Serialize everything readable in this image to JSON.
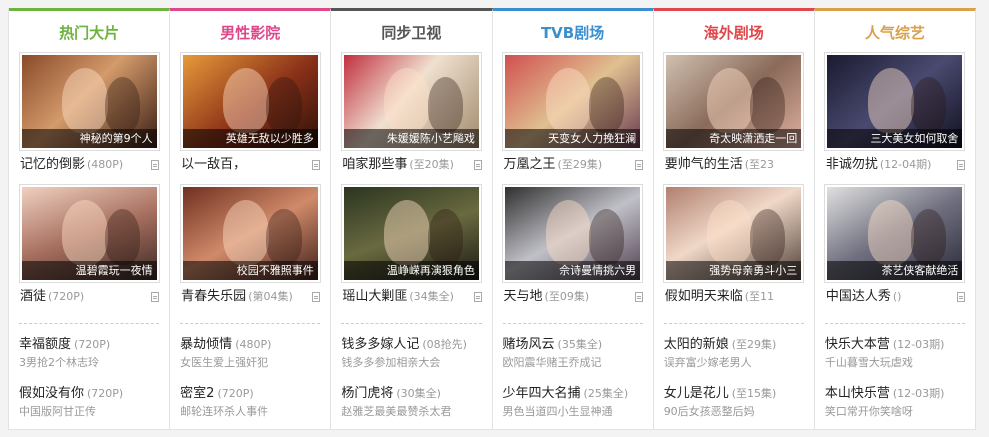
{
  "columns": [
    {
      "title": "热门大片",
      "color": "#6cb33f",
      "thumbs": [
        {
          "caption": "神秘的第9个人",
          "title": "记忆的倒影",
          "meta": "(480P)",
          "doc": true
        },
        {
          "caption": "温碧霞玩一夜情",
          "title": "酒徒",
          "meta": "(720P)",
          "doc": true
        }
      ],
      "texts": [
        {
          "title": "幸福额度",
          "meta": "(720P)",
          "sub": "3男抢2个林志玲"
        },
        {
          "title": "假如没有你",
          "meta": "(720P)",
          "sub": "中国版阿甘正传"
        }
      ]
    },
    {
      "title": "男性影院",
      "color": "#e0478a",
      "thumbs": [
        {
          "caption": "英雄无敌以少胜多",
          "title": "以一敌百，",
          "meta": "",
          "doc": true
        },
        {
          "caption": "校园不雅照事件",
          "title": "青春失乐园",
          "meta": "(第04集)",
          "doc": true
        }
      ],
      "texts": [
        {
          "title": "暴劫倾情",
          "meta": "(480P)",
          "sub": "女医生爱上强奸犯"
        },
        {
          "title": "密室2",
          "meta": "(720P)",
          "sub": "邮轮连环杀人事件"
        }
      ]
    },
    {
      "title": "同步卫视",
      "color": "#555555",
      "thumbs": [
        {
          "caption": "朱媛媛陈小艺飚戏",
          "title": "咱家那些事",
          "meta": "(至20集)",
          "doc": true
        },
        {
          "caption": "温峥嵘再演狠角色",
          "title": "瑶山大剿匪",
          "meta": "(34集全)",
          "doc": true
        }
      ],
      "texts": [
        {
          "title": "钱多多嫁人记",
          "meta": "(08抢先)",
          "sub": "钱多多参加相亲大会"
        },
        {
          "title": "杨门虎将",
          "meta": "(30集全)",
          "sub": "赵雅芝最美最赞杀太君"
        }
      ]
    },
    {
      "title": "TVB剧场",
      "color": "#3a8fd0",
      "thumbs": [
        {
          "caption": "天变女人力挽狂澜",
          "title": "万凰之王",
          "meta": "(至29集)",
          "doc": true
        },
        {
          "caption": "佘诗曼情挑六男",
          "title": "天与地",
          "meta": "(至09集)",
          "doc": true
        }
      ],
      "texts": [
        {
          "title": "赌场风云",
          "meta": "(35集全)",
          "sub": "欧阳震华赌王乔成记"
        },
        {
          "title": "少年四大名捕",
          "meta": "(25集全)",
          "sub": "男色当道四小生显神通"
        }
      ]
    },
    {
      "title": "海外剧场",
      "color": "#e0474a",
      "thumbs": [
        {
          "caption": "奇太映潇洒走一回",
          "title": "要帅气的生活",
          "meta": "(至23",
          "doc": false
        },
        {
          "caption": "强势母亲勇斗小三",
          "title": "假如明天来临",
          "meta": "(至11",
          "doc": false
        }
      ],
      "texts": [
        {
          "title": "太阳的新娘",
          "meta": "(至29集)",
          "sub": "误弃富少嫁老男人"
        },
        {
          "title": "女儿是花儿",
          "meta": "(至15集)",
          "sub": "90后女孩恶整后妈"
        }
      ]
    },
    {
      "title": "人气综艺",
      "color": "#d9a04a",
      "thumbs": [
        {
          "caption": "三大美女如何取舍",
          "title": "非诚勿扰",
          "meta": "(12-04期)",
          "doc": true
        },
        {
          "caption": "茶艺侠客献绝活",
          "title": "中国达人秀",
          "meta": "()",
          "doc": true
        }
      ],
      "texts": [
        {
          "title": "快乐大本营",
          "meta": "(12-03期)",
          "sub": "千山暮雪大玩虐戏"
        },
        {
          "title": "本山快乐营",
          "meta": "(12-03期)",
          "sub": "笑口常开你笑啥呀"
        }
      ]
    }
  ]
}
